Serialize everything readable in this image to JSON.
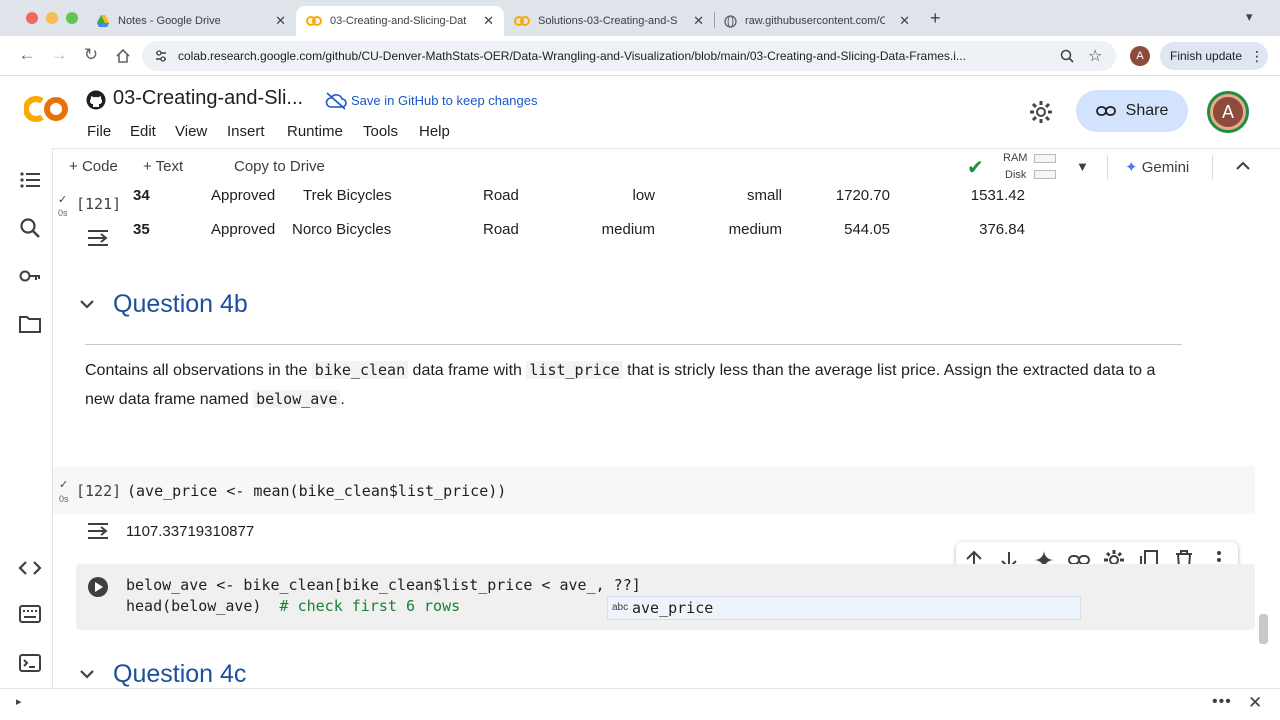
{
  "browser": {
    "tabs": [
      {
        "title": "Notes - Google Drive",
        "icon": "google-drive-icon"
      },
      {
        "title": "03-Creating-and-Slicing-Dat",
        "icon": "colab-icon"
      },
      {
        "title": "Solutions-03-Creating-and-S",
        "icon": "colab-icon"
      },
      {
        "title": "raw.githubusercontent.com/C",
        "icon": "globe-icon"
      }
    ],
    "url": "colab.research.google.com/github/CU-Denver-MathStats-OER/Data-Wrangling-and-Visualization/blob/main/03-Creating-and-Slicing-Data-Frames.i...",
    "profile_initial": "A",
    "finish_update": "Finish update"
  },
  "colab": {
    "title": "03-Creating-and-Sli...",
    "save_github": "Save in GitHub to keep changes",
    "menu": [
      "File",
      "Edit",
      "View",
      "Insert",
      "Runtime",
      "Tools",
      "Help"
    ],
    "share": "Share",
    "avatar_initial": "A",
    "toolbar": {
      "add_code": "Code",
      "add_text": "Text",
      "copy_drive": "Copy to Drive",
      "ram": "RAM",
      "disk": "Disk",
      "gemini": "Gemini"
    }
  },
  "output_table": {
    "exec_count": "[121]",
    "exec_time": "0s",
    "rows": [
      [
        "34",
        "Approved",
        "Trek Bicycles",
        "Road",
        "low",
        "small",
        "1720.70",
        "1531.42"
      ],
      [
        "35",
        "Approved",
        "Norco Bicycles",
        "Road",
        "medium",
        "medium",
        "544.05",
        "376.84"
      ]
    ]
  },
  "section_4b": {
    "heading": "Question 4b",
    "para_a": "Contains all observations in the ",
    "code_a": "bike_clean",
    "para_b": " data frame with ",
    "code_b": "list_price",
    "para_c": " that is stricly less than the average list price. Assign the extracted data to a new data frame named ",
    "code_c": "below_ave",
    "para_d": "."
  },
  "cell122": {
    "exec_count": "[122]",
    "exec_time": "0s",
    "code": "(ave_price <- mean(bike_clean$list_price))",
    "output": "1107.33719310877"
  },
  "cell123": {
    "line1": "below_ave <- bike_clean[bike_clean$list_price < ave_, ??]",
    "line2_code": "head(below_ave)  ",
    "line2_comment": "# check first 6 rows",
    "autocomplete_kind": "abc",
    "autocomplete_item": "ave_price"
  },
  "section_4c": {
    "heading": "Question 4c"
  },
  "colors": {
    "accent_blue": "#1a57c9",
    "heading_blue": "#1c4f9c",
    "share_bg": "#d3e3fd",
    "colab_orange": "#f9ab00",
    "check_green": "#1e8e3e"
  }
}
